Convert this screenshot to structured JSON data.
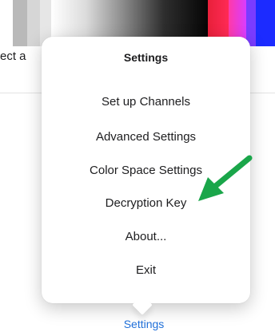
{
  "background": {
    "partial_label": "ect a"
  },
  "popover": {
    "title": "Settings",
    "items": [
      {
        "label": "Set up Channels"
      },
      {
        "label": "Advanced Settings"
      },
      {
        "label": "Color Space Settings"
      },
      {
        "label": "Decryption Key"
      },
      {
        "label": "About..."
      },
      {
        "label": "Exit"
      }
    ]
  },
  "bottom_bar": {
    "settings_label": "Settings",
    "accent_color": "#1f6fd8"
  },
  "annotation": {
    "icon": "green-arrow-icon",
    "color": "#1aa64a",
    "points_to": "Decryption Key"
  }
}
